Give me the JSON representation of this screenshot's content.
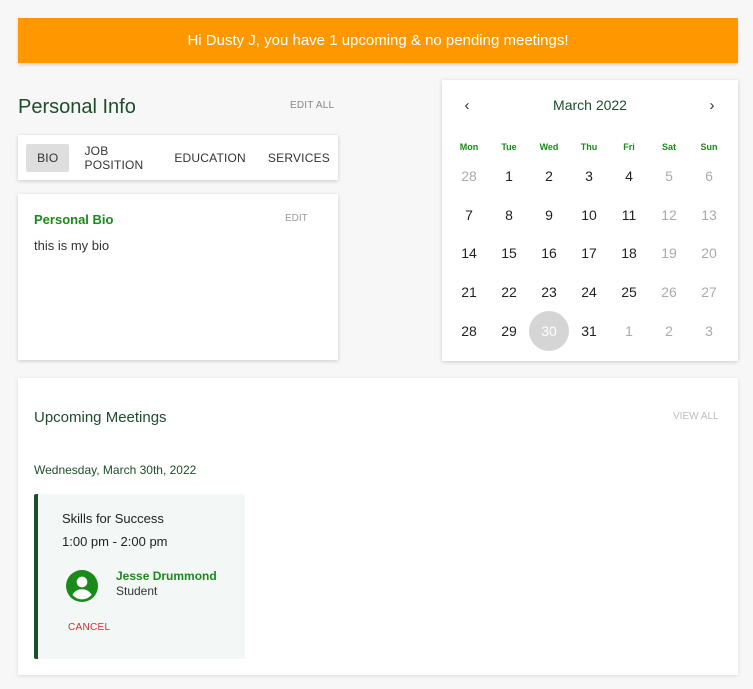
{
  "banner": {
    "text": "Hi Dusty J, you have 1 upcoming & no pending meetings!"
  },
  "personal_info": {
    "title": "Personal Info",
    "edit_all": "EDIT ALL",
    "tabs": [
      "BIO",
      "JOB POSITION",
      "EDUCATION",
      "SERVICES"
    ],
    "active_tab": "BIO",
    "bio": {
      "title": "Personal Bio",
      "edit": "EDIT",
      "text": "this is my bio"
    }
  },
  "calendar": {
    "title": "March 2022",
    "prev": "‹",
    "next": "›",
    "weekdays": [
      "Mon",
      "Tue",
      "Wed",
      "Thu",
      "Fri",
      "Sat",
      "Sun"
    ],
    "weeks": [
      [
        "28",
        "1",
        "2",
        "3",
        "4",
        "5",
        "6"
      ],
      [
        "7",
        "8",
        "9",
        "10",
        "11",
        "12",
        "13"
      ],
      [
        "14",
        "15",
        "16",
        "17",
        "18",
        "19",
        "20"
      ],
      [
        "21",
        "22",
        "23",
        "24",
        "25",
        "26",
        "27"
      ],
      [
        "28",
        "29",
        "30",
        "31",
        "1",
        "2",
        "3"
      ]
    ],
    "selected": "30",
    "colors": {
      "accent": "#1a8a1a",
      "heading": "#1e4d2b",
      "selected_bg": "#d5d5d5"
    }
  },
  "meetings": {
    "title": "Upcoming Meetings",
    "view_all": "VIEW ALL",
    "date": "Wednesday, March 30th, 2022",
    "items": [
      {
        "title": "Skills for Success",
        "time": "1:00 pm - 2:00 pm",
        "attendee_name": "Jesse Drummond",
        "attendee_role": "Student",
        "avatar_icon": "account-circle-icon",
        "cancel": "CANCEL"
      }
    ]
  },
  "colors": {
    "banner": "#ff9800",
    "brand_green": "#1e4d2b",
    "cancel_red": "#d32f2f"
  }
}
